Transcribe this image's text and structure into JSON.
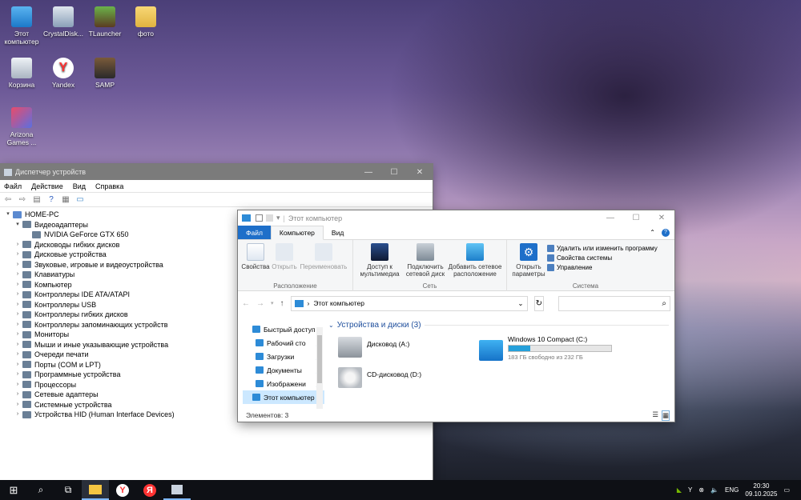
{
  "desktop": {
    "icons": [
      {
        "label": "Этот компьютер",
        "icon": "this-pc-icon"
      },
      {
        "label": "CrystalDisk...",
        "icon": "crystaldisk-icon"
      },
      {
        "label": "TLauncher",
        "icon": "tlauncher-icon"
      },
      {
        "label": "фото",
        "icon": "folder-icon"
      },
      {
        "label": "Корзина",
        "icon": "recycle-bin-icon"
      },
      {
        "label": "Yandex",
        "icon": "yandex-browser-icon"
      },
      {
        "label": "SAMP",
        "icon": "samp-icon"
      },
      {
        "label": "Arizona Games ...",
        "icon": "arizona-games-icon"
      }
    ]
  },
  "devmgr": {
    "title": "Диспетчер устройств",
    "menu": [
      "Файл",
      "Действие",
      "Вид",
      "Справка"
    ],
    "root": "HOME-PC",
    "items": [
      {
        "label": "Видеоадаптеры",
        "expanded": true
      },
      {
        "label": "NVIDIA GeForce GTX 650",
        "child": true
      },
      {
        "label": "Дисководы гибких дисков"
      },
      {
        "label": "Дисковые устройства"
      },
      {
        "label": "Звуковые, игровые и видеоустройства"
      },
      {
        "label": "Клавиатуры"
      },
      {
        "label": "Компьютер"
      },
      {
        "label": "Контроллеры IDE ATA/ATAPI"
      },
      {
        "label": "Контроллеры USB"
      },
      {
        "label": "Контроллеры гибких дисков"
      },
      {
        "label": "Контроллеры запоминающих устройств"
      },
      {
        "label": "Мониторы"
      },
      {
        "label": "Мыши и иные указывающие устройства"
      },
      {
        "label": "Очереди печати"
      },
      {
        "label": "Порты (COM и LPT)"
      },
      {
        "label": "Программные устройства"
      },
      {
        "label": "Процессоры"
      },
      {
        "label": "Сетевые адаптеры"
      },
      {
        "label": "Системные устройства"
      },
      {
        "label": "Устройства HID (Human Interface Devices)"
      }
    ]
  },
  "explorer": {
    "title": "Этот компьютер",
    "tabs": {
      "file": "Файл",
      "computer": "Компьютер",
      "view": "Вид"
    },
    "ribbon": {
      "location": {
        "label": "Расположение",
        "properties": "Свойства",
        "open": "Открыть",
        "rename": "Переименовать"
      },
      "network": {
        "label": "Сеть",
        "media": "Доступ к мультимедиа",
        "map": "Подключить сетевой диск",
        "add": "Добавить сетевое расположение"
      },
      "system": {
        "label": "Система",
        "settings": "Открыть параметры",
        "uninstall": "Удалить или изменить программу",
        "sysprops": "Свойства системы",
        "manage": "Управление"
      }
    },
    "address": "Этот компьютер",
    "nav": [
      {
        "label": "Быстрый доступ",
        "pin": false
      },
      {
        "label": "Рабочий сто",
        "pin": true
      },
      {
        "label": "Загрузки",
        "pin": true
      },
      {
        "label": "Документы",
        "pin": true
      },
      {
        "label": "Изображени",
        "pin": true
      },
      {
        "label": "Этот компьютер",
        "pin": false
      }
    ],
    "section": "Устройства и диски (3)",
    "drives": {
      "floppy": "Дисковод (A:)",
      "cd": "CD-дисковод (D:)",
      "c": {
        "name": "Windows 10 Compact  (C:)",
        "free": "183 ГБ свободно из 232 ГБ",
        "used_fraction": 0.21
      }
    },
    "status": "Элементов: 3"
  },
  "taskbar": {
    "lang": "ENG",
    "time": "20:30",
    "date": "09.10.2025"
  },
  "colors": {
    "accent": "#1e6fc9",
    "bar": "#26a0da"
  }
}
